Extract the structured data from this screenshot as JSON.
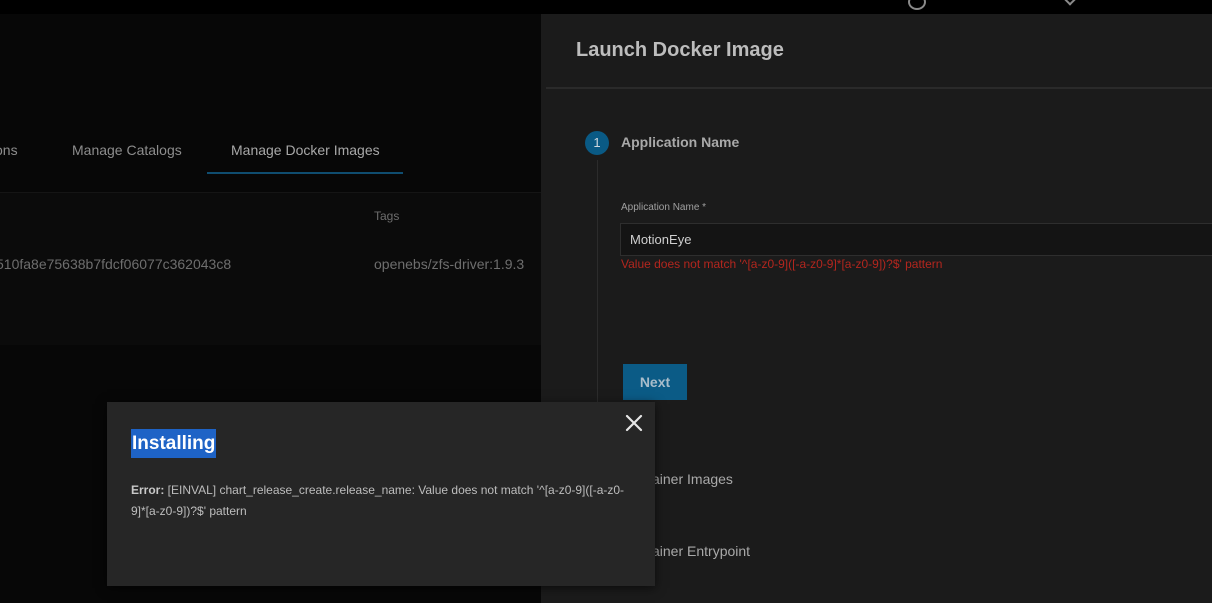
{
  "left_app": {
    "tabs": [
      {
        "label": "ons"
      },
      {
        "label": "Manage Catalogs"
      },
      {
        "label": "Manage Docker Images"
      }
    ],
    "table": {
      "column_header": "Tags",
      "row": {
        "id": "510fa8e75638b7fdcf06077c362043c8",
        "tag": "openebs/zfs-driver:1.9.3"
      }
    }
  },
  "panel": {
    "title": "Launch Docker Image",
    "step1": {
      "number": "1",
      "label": "Application Name"
    },
    "field_label": "Application Name *",
    "field_value": "MotionEye",
    "field_error": "Value does not match '^[a-z0-9]([-a-z0-9]*[a-z0-9])?$' pattern",
    "next_label": "Next",
    "step2_label": "ainer Images",
    "step3_label": "ainer Entrypoint"
  },
  "modal": {
    "title": "Installing",
    "error_prefix": "Error:",
    "error_message": " [EINVAL] chart_release_create.release_name: Value does not match '^[a-z0-9]([-a-z0-9]*[a-z0-9])?$' pattern"
  },
  "colors": {
    "accent": "#0b5b86",
    "error": "#b3261e",
    "selection": "#1e63c6"
  }
}
